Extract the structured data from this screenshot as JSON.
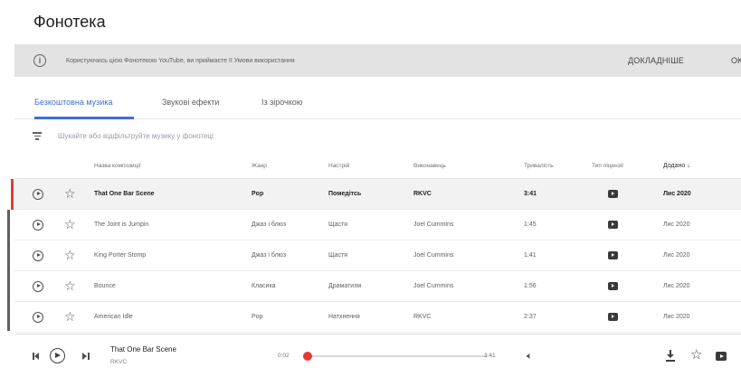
{
  "page": {
    "title": "Фонотека"
  },
  "notice": {
    "text": "Користуючись цією Фонотекою YouTube, ви приймаєте її Умови використання",
    "more_label": "ДОКЛАДНІШЕ",
    "ok_label": "OK"
  },
  "tabs": [
    {
      "label": "Безкоштовна музика",
      "active": true
    },
    {
      "label": "Звукові ефекти",
      "active": false
    },
    {
      "label": "Із зірочкою",
      "active": false
    }
  ],
  "search": {
    "placeholder": "Шукайте або відфільтруйте музику у фонотеці"
  },
  "table": {
    "headers": {
      "name": "Назва композиції",
      "genre": "Жанр",
      "mood": "Настрій",
      "artist": "Виконавець",
      "duration": "Тривалість",
      "license": "Тип ліцензії",
      "added": "Додано ↓"
    },
    "rows": [
      {
        "name": "That One Bar Scene",
        "genre": "Pop",
        "mood": "Помедітсь",
        "artist": "RKVC",
        "duration": "3:41",
        "added": "Лис 2020",
        "selected": true
      },
      {
        "name": "The Joint is Jumpin",
        "genre": "Джаз і блюз",
        "mood": "Щастя",
        "artist": "Joel Cummins",
        "duration": "1:45",
        "added": "Лис 2020",
        "selected": false
      },
      {
        "name": "King Porter Stomp",
        "genre": "Джаз і блюз",
        "mood": "Щастя",
        "artist": "Joel Cummins",
        "duration": "1:41",
        "added": "Лис 2020",
        "selected": false
      },
      {
        "name": "Bounce",
        "genre": "Класика",
        "mood": "Драматизм",
        "artist": "Joel Cummins",
        "duration": "1:56",
        "added": "Лис 2020",
        "selected": false
      },
      {
        "name": "American Idle",
        "genre": "Pop",
        "mood": "Натхнення",
        "artist": "RKVC",
        "duration": "2:37",
        "added": "Лис 2020",
        "selected": false
      }
    ]
  },
  "player": {
    "title": "That One Bar Scene",
    "artist": "RKVC",
    "current_time": "0:02",
    "total_time": "3:41",
    "progress_fraction": 0.01
  },
  "colors": {
    "accent": "#3f6fd8",
    "progress": "#e53935"
  }
}
